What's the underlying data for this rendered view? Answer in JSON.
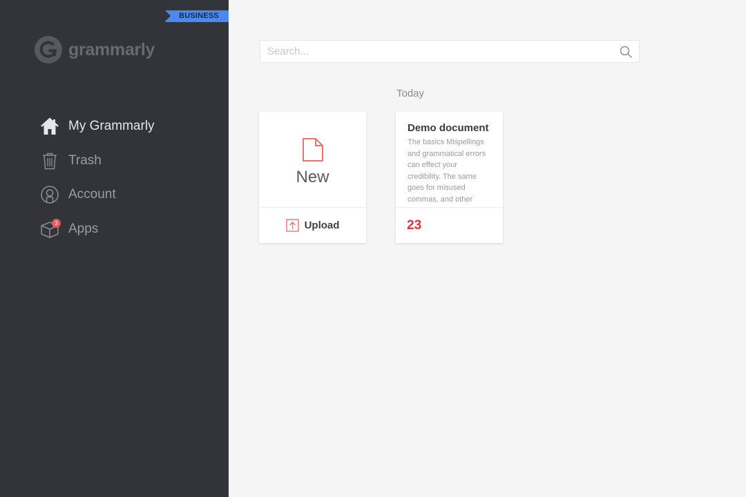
{
  "sidebar": {
    "plan_badge": "BUSINESS",
    "logo_text": "grammarly",
    "items": [
      {
        "label": "My Grammarly",
        "icon": "home-icon",
        "active": true
      },
      {
        "label": "Trash",
        "icon": "trash-icon"
      },
      {
        "label": "Account",
        "icon": "account-icon"
      },
      {
        "label": "Apps",
        "icon": "apps-box-icon",
        "badge": "3"
      }
    ]
  },
  "search": {
    "placeholder": "Search...",
    "icon": "search-icon"
  },
  "main": {
    "section_heading": "Today",
    "new_card": {
      "label": "New",
      "icon": "new-document-icon",
      "upload_label": "Upload",
      "upload_icon": "upload-icon"
    },
    "documents": [
      {
        "title": "Demo document",
        "snippet": "The basics Mispellings and grammatical errors can effect your credibility. The same goes for misused commas, and other",
        "issue_count": "23"
      }
    ]
  },
  "colors": {
    "sidebar_bg": "#33343a",
    "badge_blue": "#4a8af0",
    "accent_red": "#e0303e",
    "icon_coral": "#e8746e",
    "page_bg": "#f5f5f5"
  }
}
